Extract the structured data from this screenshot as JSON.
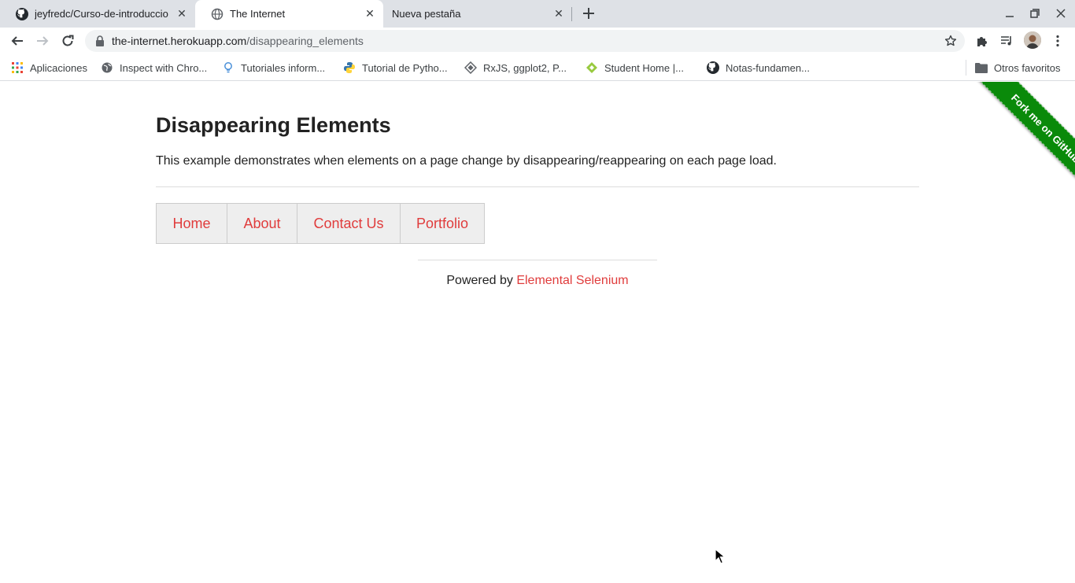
{
  "tabs": [
    {
      "title": "jeyfredc/Curso-de-introduccio",
      "icon": "github-icon",
      "active": false
    },
    {
      "title": "The Internet",
      "icon": "globe-icon",
      "active": true
    },
    {
      "title": "Nueva pestaña",
      "icon": "none",
      "active": false
    }
  ],
  "address_bar": {
    "host": "the-internet.herokuapp.com",
    "path": "/disappearing_elements"
  },
  "bookmarks": [
    {
      "label": "Aplicaciones",
      "icon": "apps-grid-icon"
    },
    {
      "label": "Inspect with Chro...",
      "icon": "globe-icon"
    },
    {
      "label": "Tutoriales inform...",
      "icon": "lightbulb-icon"
    },
    {
      "label": "Tutorial de Pytho...",
      "icon": "python-icon"
    },
    {
      "label": "RxJS, ggplot2, P...",
      "icon": "diamond-icon"
    },
    {
      "label": "Student Home |...",
      "icon": "student-diamond-icon"
    },
    {
      "label": "Notas-fundamen...",
      "icon": "github-icon"
    }
  ],
  "other_bookmarks": {
    "label": "Otros favoritos",
    "icon": "folder-icon"
  },
  "page": {
    "heading": "Disappearing Elements",
    "description": "This example demonstrates when elements on a page change by disappearing/reappearing on each page load.",
    "menu": [
      "Home",
      "About",
      "Contact Us",
      "Portfolio"
    ],
    "footer_prefix": "Powered by ",
    "footer_link": "Elemental Selenium",
    "ribbon": "Fork me on GitHub"
  },
  "colors": {
    "link": "#e03c3c",
    "ribbon": "#0a8a0a",
    "menu_bg": "#eeeeee"
  }
}
